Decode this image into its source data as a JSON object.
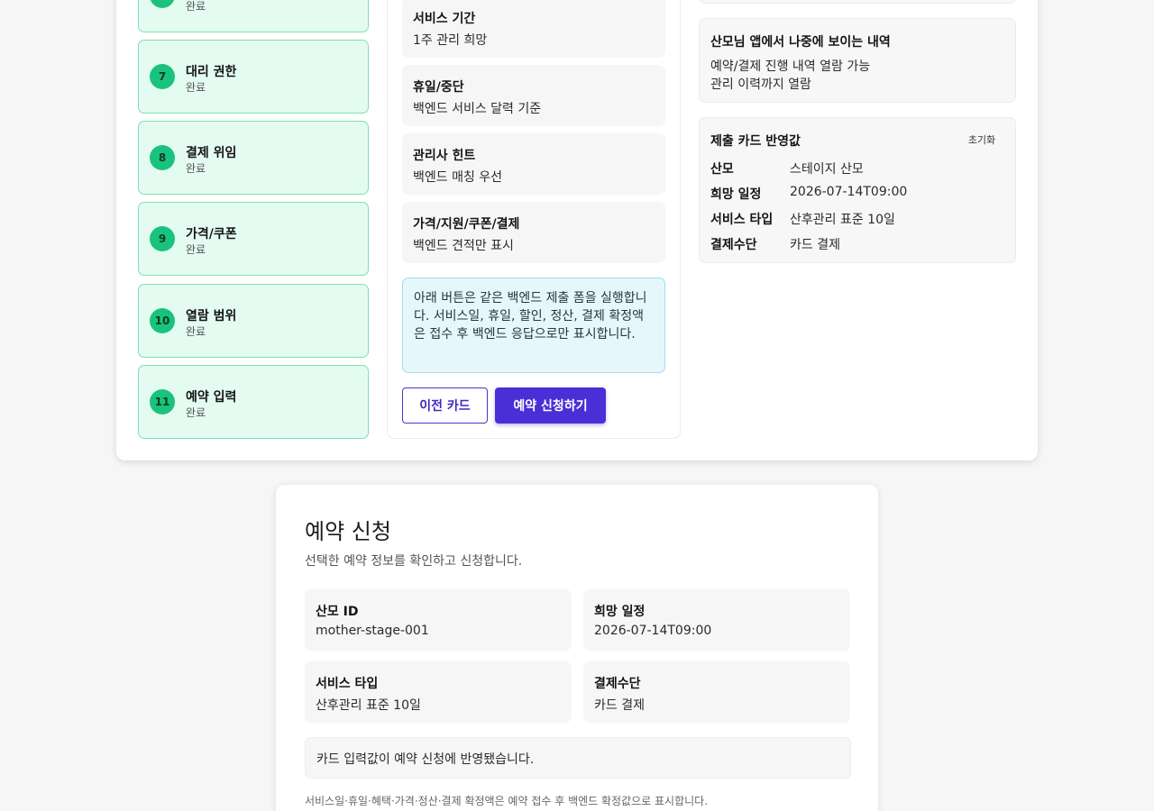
{
  "steps": [
    {
      "num": "",
      "title": "",
      "status": "완료"
    },
    {
      "num": "7",
      "title": "대리 권한",
      "status": "완료"
    },
    {
      "num": "8",
      "title": "결제 위임",
      "status": "완료"
    },
    {
      "num": "9",
      "title": "가격/쿠폰",
      "status": "완료"
    },
    {
      "num": "10",
      "title": "열람 범위",
      "status": "완료"
    },
    {
      "num": "11",
      "title": "예약 입력",
      "status": "완료"
    }
  ],
  "middle": {
    "cards": [
      {
        "label": "서비스 기간",
        "value": "1주 관리 희망"
      },
      {
        "label": "휴일/중단",
        "value": "백엔드 서비스 달력 기준"
      },
      {
        "label": "관리사 힌트",
        "value": "백엔드 매칭 우선"
      },
      {
        "label": "가격/지원/쿠폰/결제",
        "value": "백엔드 견적만 표시"
      }
    ],
    "notice": "아래 버튼은 같은 백엔드 제출 폼을 실행합니다. 서비스일, 휴일, 할인, 정산, 결제 확정액은 접수 후 백엔드 응답으로만 표시합니다.",
    "prev_button": "이전 카드",
    "submit_button": "예약 신청하기"
  },
  "right": {
    "visible_title": "산모님 앱에서 나중에 보이는 내역",
    "visible_lines": [
      "예약/결제 진행 내역 열람 가능",
      "관리 이력까지 열람"
    ],
    "reflect_title": "제출 카드 반영값",
    "reset_button": "초기화",
    "reflect_rows": [
      {
        "key": "산모",
        "value": "스테이지 산모"
      },
      {
        "key": "희망 일정",
        "value": "2026-07-14T09:00"
      },
      {
        "key": "서비스 타입",
        "value": "산후관리 표준 10일"
      },
      {
        "key": "결제수단",
        "value": "카드 결제"
      }
    ]
  },
  "reservation": {
    "title": "예약 신청",
    "subtitle": "선택한 예약 정보를 확인하고 신청합니다.",
    "fields": [
      {
        "label": "산모 ID",
        "value": "mother-stage-001"
      },
      {
        "label": "희망 일정",
        "value": "2026-07-14T09:00"
      },
      {
        "label": "서비스 타입",
        "value": "산후관리 표준 10일"
      },
      {
        "label": "결제수단",
        "value": "카드 결제"
      }
    ],
    "reflect_message": "카드 입력값이 예약 신청에 반영됐습니다.",
    "footnote": "서비스일·휴일·혜택·가격·정산·결제 확정액은 예약 접수 후 백엔드 확정값으로 표시합니다."
  }
}
